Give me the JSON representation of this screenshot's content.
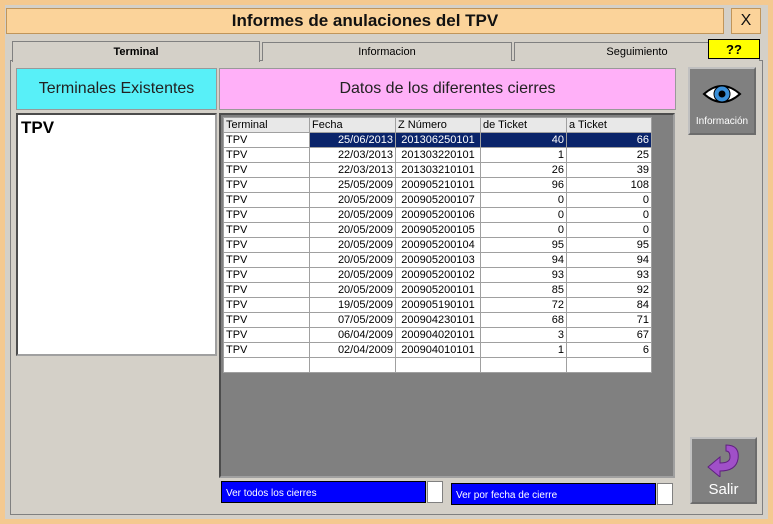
{
  "window": {
    "title": "Informes de anulaciones del TPV",
    "close_label": "X"
  },
  "tabs": [
    {
      "label": "Terminal"
    },
    {
      "label": "Informacion"
    },
    {
      "label": "Seguimiento"
    }
  ],
  "help_label": "??",
  "left_header": "Terminales Existentes",
  "right_header": "Datos de los diferentes cierres",
  "terminals": [
    "TPV"
  ],
  "grid": {
    "columns": [
      "Terminal",
      "Fecha",
      "Z Número",
      "de Ticket",
      "a Ticket"
    ],
    "rows": [
      [
        "TPV",
        "25/06/2013",
        "201306250101",
        "40",
        "66"
      ],
      [
        "TPV",
        "22/03/2013",
        "201303220101",
        "1",
        "25"
      ],
      [
        "TPV",
        "22/03/2013",
        "201303210101",
        "26",
        "39"
      ],
      [
        "TPV",
        "25/05/2009",
        "200905210101",
        "96",
        "108"
      ],
      [
        "TPV",
        "20/05/2009",
        "200905200107",
        "0",
        "0"
      ],
      [
        "TPV",
        "20/05/2009",
        "200905200106",
        "0",
        "0"
      ],
      [
        "TPV",
        "20/05/2009",
        "200905200105",
        "0",
        "0"
      ],
      [
        "TPV",
        "20/05/2009",
        "200905200104",
        "95",
        "95"
      ],
      [
        "TPV",
        "20/05/2009",
        "200905200103",
        "94",
        "94"
      ],
      [
        "TPV",
        "20/05/2009",
        "200905200102",
        "93",
        "93"
      ],
      [
        "TPV",
        "20/05/2009",
        "200905200101",
        "85",
        "92"
      ],
      [
        "TPV",
        "19/05/2009",
        "200905190101",
        "72",
        "84"
      ],
      [
        "TPV",
        "07/05/2009",
        "200904230101",
        "68",
        "71"
      ],
      [
        "TPV",
        "06/04/2009",
        "200904020101",
        "3",
        "67"
      ],
      [
        "TPV",
        "02/04/2009",
        "200904010101",
        "1",
        "6"
      ]
    ]
  },
  "buttons": {
    "info_label": "Información",
    "exit_label": "Salir",
    "all_closings": "Ver todos los cierres",
    "by_date": "Ver por fecha de cierre"
  },
  "colors": {
    "cyan": "#58f0f8",
    "pink": "#ffb0f8",
    "selection": "#0a246a",
    "accent_blue": "#0000ff"
  }
}
